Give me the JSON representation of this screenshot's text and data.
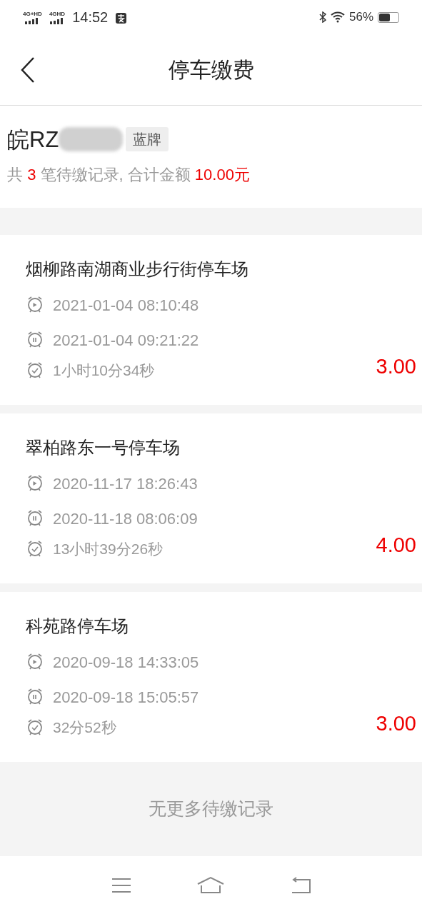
{
  "status_bar": {
    "signal_1": "4G+HD",
    "signal_2": "4GHD",
    "time": "14:52",
    "battery": "56%"
  },
  "header": {
    "title": "停车缴费"
  },
  "vehicle": {
    "plate": "皖RZ",
    "plate_type": "蓝牌",
    "summary_prefix": "共",
    "count": "3",
    "summary_middle": "笔待缴记录, 合计金额",
    "total": "10.00元"
  },
  "records": [
    {
      "lot": "烟柳路南湖商业步行街停车场",
      "start": "2021-01-04 08:10:48",
      "end": "2021-01-04 09:21:22",
      "duration": "1小时10分34秒",
      "amount": "3.00"
    },
    {
      "lot": "翠柏路东一号停车场",
      "start": "2020-11-17 18:26:43",
      "end": "2020-11-18 08:06:09",
      "duration": "13小时39分26秒",
      "amount": "4.00"
    },
    {
      "lot": "科苑路停车场",
      "start": "2020-09-18 14:33:05",
      "end": "2020-09-18 15:05:57",
      "duration": "32分52秒",
      "amount": "3.00"
    }
  ],
  "footer_note": "无更多待缴记录"
}
